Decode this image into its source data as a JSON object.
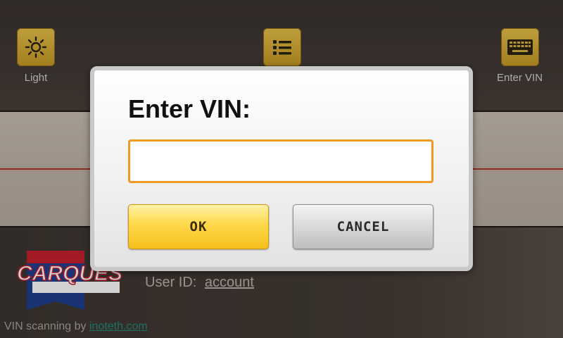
{
  "toolbar": {
    "light": {
      "label": "Light",
      "icon": "sun-icon"
    },
    "list": {
      "label": "",
      "icon": "list-icon"
    },
    "enter_vin": {
      "label": "Enter VIN",
      "icon": "keyboard-icon"
    }
  },
  "main": {
    "logo_text": "CARQUEST",
    "user_id_label": "User ID:",
    "user_id_value": "account",
    "credit_prefix": "VIN scanning by",
    "credit_link": "inoteth.com"
  },
  "dialog": {
    "title": "Enter VIN:",
    "vin_value": "",
    "vin_placeholder": "",
    "ok_label": "OK",
    "cancel_label": "CANCEL"
  },
  "colors": {
    "accent_yellow": "#f6bf1c",
    "input_border": "#ef9a22",
    "scan_line": "#b0322a",
    "logo_red": "#c6202e",
    "logo_blue": "#1f3f8f"
  }
}
